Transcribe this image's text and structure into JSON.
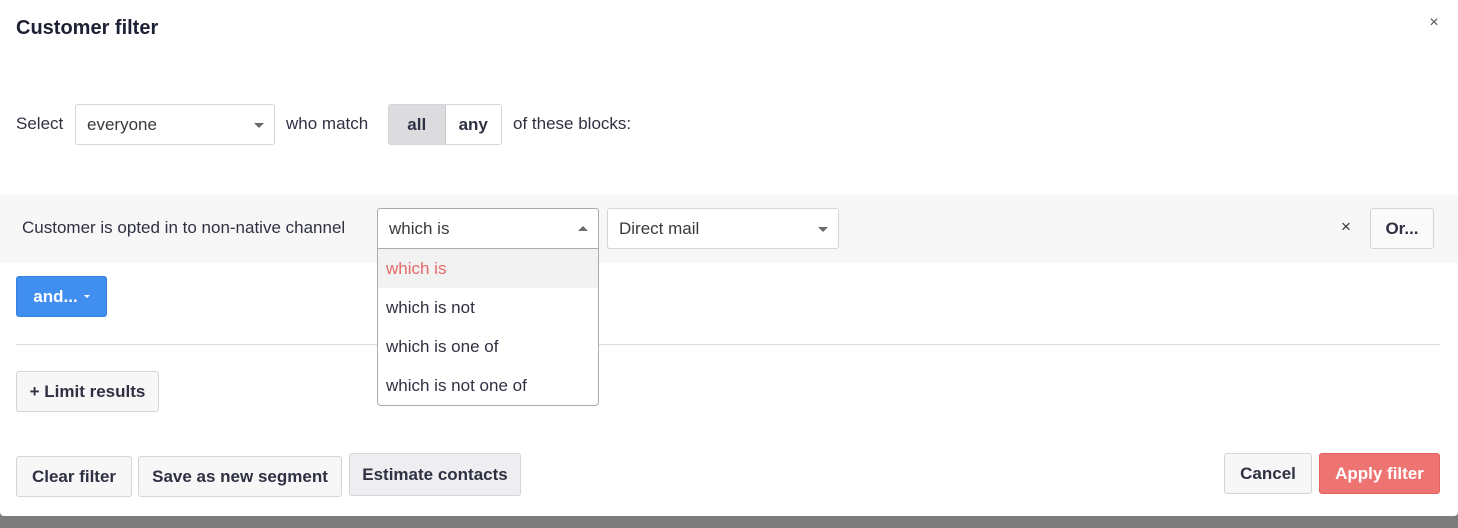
{
  "dialog": {
    "title": "Customer filter",
    "close_label": "×"
  },
  "select_row": {
    "prefix": "Select",
    "audience_value": "everyone",
    "match_label": "who match",
    "match_options": [
      "all",
      "any"
    ],
    "match_selected": "all",
    "suffix": "of these blocks:"
  },
  "block": {
    "label": "Customer is opted in to non-native channel",
    "operator_value": "which is",
    "channel_value": "Direct mail",
    "remove_label": "×",
    "or_label": "Or..."
  },
  "operator_dropdown": {
    "options": [
      "which is",
      "which is not",
      "which is one of",
      "which is not one of"
    ],
    "selected": "which is"
  },
  "and_button": {
    "label": "and..."
  },
  "limit_button": {
    "label": "+ Limit results"
  },
  "footer": {
    "clear": "Clear filter",
    "save_segment": "Save as new segment",
    "estimate": "Estimate contacts",
    "cancel": "Cancel",
    "apply": "Apply filter"
  },
  "colors": {
    "primary": "#3f8ef0",
    "danger": "#ee7471",
    "selected_option_text": "#e46a67",
    "block_background": "#f7f7f8"
  }
}
